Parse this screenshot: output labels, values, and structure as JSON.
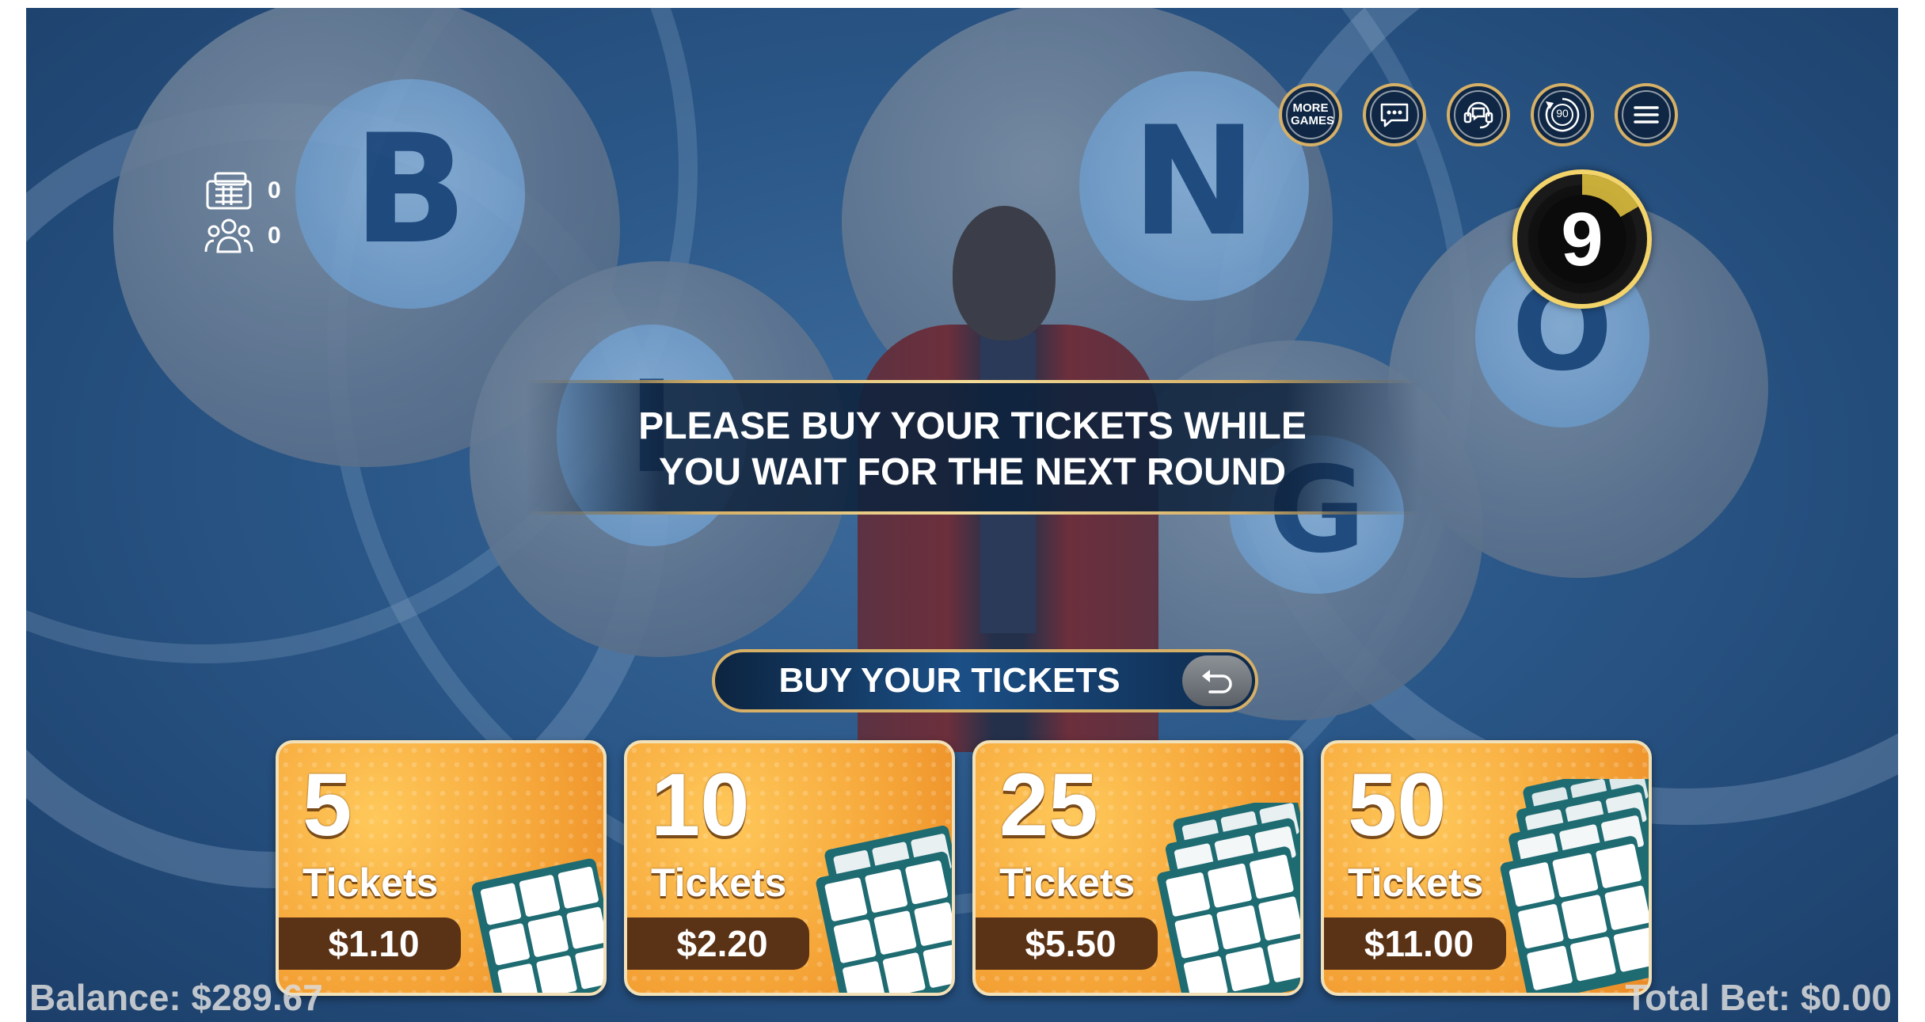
{
  "background": {
    "ball_letters": [
      "B",
      "N",
      "I",
      "G",
      "O"
    ]
  },
  "top_bar": {
    "more_games_label": "MORE GAMES",
    "autoplay_count": "90",
    "icons": [
      "more-games-icon",
      "chat-icon",
      "support-icon",
      "autoplay-icon",
      "menu-icon"
    ]
  },
  "counters": {
    "tickets": "0",
    "players": "0"
  },
  "countdown": {
    "value": "9"
  },
  "message": {
    "line1": "PLEASE BUY YOUR TICKETS WHILE",
    "line2": "YOU WAIT FOR THE NEXT ROUND"
  },
  "buy_bar": {
    "label": "BUY YOUR TICKETS"
  },
  "ticket_cards": [
    {
      "qty": "5",
      "word": "Tickets",
      "price": "$1.10"
    },
    {
      "qty": "10",
      "word": "Tickets",
      "price": "$2.20"
    },
    {
      "qty": "25",
      "word": "Tickets",
      "price": "$5.50"
    },
    {
      "qty": "50",
      "word": "Tickets",
      "price": "$11.00"
    }
  ],
  "footer": {
    "balance": "Balance: $289.67",
    "total_bet": "Total Bet: $0.00"
  },
  "colors": {
    "gold": "#d6b066",
    "card_orange": "#f6a73a",
    "price_brown": "#5a3215",
    "bg_blue": "#2a5788"
  }
}
